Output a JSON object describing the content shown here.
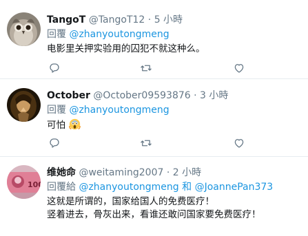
{
  "tweets": [
    {
      "name": "TangoT",
      "handle": "@TangoT12",
      "separator": "·",
      "time": "5 小時",
      "reply_prefix": "回覆",
      "mentions": [
        "@zhanyoutongmeng"
      ],
      "text_lines": [
        "电影里关押实验用的囚犯不就这种么。"
      ]
    },
    {
      "name": "October",
      "handle": "@October09593876",
      "separator": "·",
      "time": "3 小時",
      "reply_prefix": "回覆",
      "mentions": [
        "@zhanyoutongmeng"
      ],
      "text_lines": [
        "可怕"
      ],
      "emoji": "screaming-face-emoji"
    },
    {
      "name": "维她命",
      "handle": "@weitaming2007",
      "separator": "·",
      "time": "2 小時",
      "reply_prefix": "回覆給",
      "mentions": [
        "@zhanyoutongmeng",
        "@JoannePan373"
      ],
      "mention_joiner": "和",
      "text_lines": [
        "这就是所谓的，国家给国人的免费医疗！",
        "竖着进去，骨灰出来，看谁还敢问国家要免费医疗！"
      ]
    }
  ],
  "icons": {
    "reply": "reply-icon",
    "retweet": "retweet-icon",
    "like": "heart-icon"
  },
  "colors": {
    "mention": "#1b95e0",
    "secondary_text": "#657786",
    "divider": "#e6ecf0"
  }
}
